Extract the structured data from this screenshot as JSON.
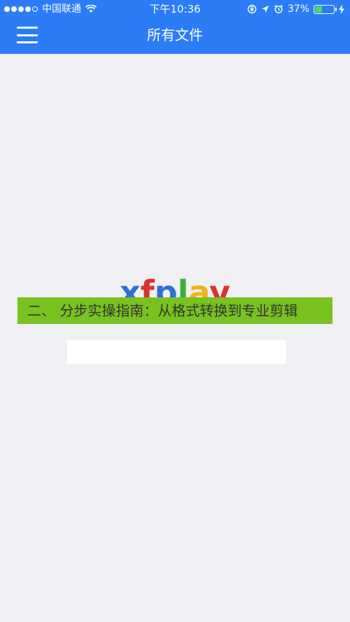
{
  "status_bar": {
    "carrier": "中国联通",
    "time": "下午10:36",
    "battery_percent": "37%",
    "battery_level": 0.37
  },
  "nav": {
    "title": "所有文件",
    "menu_icon": "hamburger-menu-icon"
  },
  "logo": {
    "text": "xfplay",
    "letters": [
      "x",
      "f",
      "p",
      "l",
      "a",
      "y"
    ],
    "letter_colors": [
      "#2E6FD8",
      "#D9322E",
      "#2E6FD8",
      "#3AAE3F",
      "#F2B21B",
      "#D9322E"
    ]
  },
  "banner": {
    "text": "二、 分步实操指南：从格式转换到专业剪辑"
  },
  "colors": {
    "header_bg": "#2C7CF6",
    "page_bg": "#EFEFF4",
    "banner_bg": "#79C21F"
  }
}
